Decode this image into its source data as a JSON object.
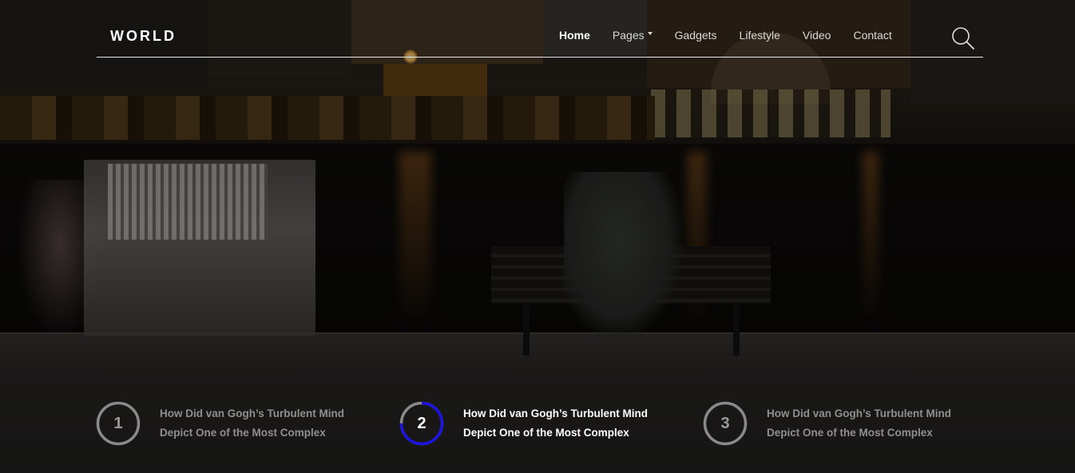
{
  "header": {
    "logo": "WORLD",
    "nav": [
      {
        "label": "Home",
        "active": true
      },
      {
        "label": "Pages",
        "dropdown": true
      },
      {
        "label": "Gadgets"
      },
      {
        "label": "Lifestyle"
      },
      {
        "label": "Video"
      },
      {
        "label": "Contact"
      }
    ],
    "search_icon": "search-icon"
  },
  "slider": {
    "active_color": "#1a12e0",
    "items": [
      {
        "number": "1",
        "title_line1": "How Did van Gogh’s Turbulent Mind",
        "title_line2": "Depict One of the Most Complex",
        "active": false
      },
      {
        "number": "2",
        "title_line1": "How Did van Gogh’s Turbulent Mind",
        "title_line2": "Depict One of the Most Complex",
        "active": true,
        "progress": 0.75
      },
      {
        "number": "3",
        "title_line1": "How Did van Gogh’s Turbulent Mind",
        "title_line2": "Depict One of the Most Complex",
        "active": false
      }
    ]
  }
}
